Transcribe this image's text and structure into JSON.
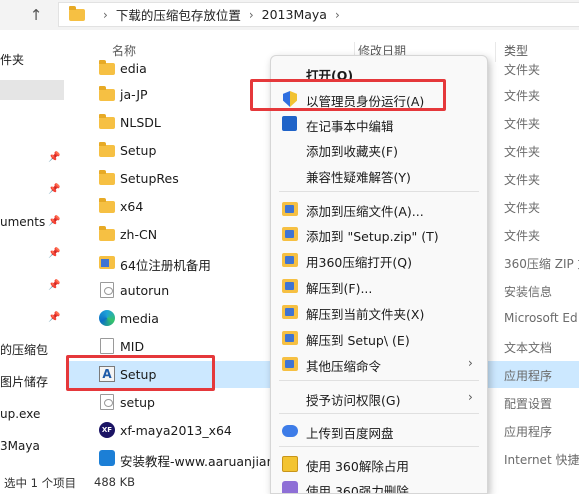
{
  "address_bar": {
    "up_arrow": "↑",
    "separator": "›",
    "crumbs": [
      "下载的压缩包存放位置",
      "2013Maya"
    ]
  },
  "nav": {
    "items": [
      {
        "label": "件夹",
        "pinned": false
      },
      {
        "label": "",
        "pinned": false
      },
      {
        "label": "",
        "pinned": true
      },
      {
        "label": "",
        "pinned": true
      },
      {
        "label": "uments",
        "pinned": true
      },
      {
        "label": "",
        "pinned": true
      },
      {
        "label": "",
        "pinned": true
      },
      {
        "label": "",
        "pinned": true
      },
      {
        "label": "的压缩包",
        "pinned": false
      },
      {
        "label": "图片储存",
        "pinned": false
      },
      {
        "label": "up.exe",
        "pinned": false
      },
      {
        "label": "3Maya",
        "pinned": false
      }
    ]
  },
  "list": {
    "columns": {
      "name": "名称",
      "date": "修改日期",
      "type": "类型"
    },
    "rows": [
      {
        "name": "edia",
        "type": "文件夹",
        "icon": "folder"
      },
      {
        "name": "ja-JP",
        "type": "文件夹",
        "icon": "folder"
      },
      {
        "name": "NLSDL",
        "type": "文件夹",
        "icon": "folder"
      },
      {
        "name": "Setup",
        "type": "文件夹",
        "icon": "folder"
      },
      {
        "name": "SetupRes",
        "type": "文件夹",
        "icon": "folder"
      },
      {
        "name": "x64",
        "type": "文件夹",
        "icon": "folder"
      },
      {
        "name": "zh-CN",
        "type": "文件夹",
        "icon": "folder"
      },
      {
        "name": "64位注册机备用",
        "type": "360压缩 ZIP 文",
        "icon": "zip"
      },
      {
        "name": "autorun",
        "type": "安装信息",
        "icon": "gear-file"
      },
      {
        "name": "media",
        "type": "Microsoft Ed",
        "icon": "edge"
      },
      {
        "name": "MID",
        "type": "文本文档",
        "icon": "doc"
      },
      {
        "name": "Setup",
        "type": "应用程序",
        "icon": "setup-exe",
        "selected": true
      },
      {
        "name": "setup",
        "type": "配置设置",
        "icon": "gear-file"
      },
      {
        "name": "xf-maya2013_x64",
        "type": "应用程序",
        "icon": "xf"
      },
      {
        "name": "安装教程-www.aaruanjian.co",
        "type": "Internet 快捷",
        "icon": "shortcut"
      }
    ]
  },
  "status": {
    "selected": "选中 1 个项目",
    "size": "488 KB"
  },
  "context_menu": {
    "items": [
      {
        "label": "打开(O)",
        "bold": true,
        "icon": "",
        "arrow": false
      },
      {
        "label": "以管理员身份运行(A)",
        "icon": "shield",
        "arrow": false
      },
      {
        "label": "在记事本中编辑",
        "icon": "notepad",
        "arrow": false
      },
      {
        "label": "添加到收藏夹(F)",
        "icon": "",
        "arrow": false
      },
      {
        "label": "兼容性疑难解答(Y)",
        "icon": "",
        "arrow": false
      },
      {
        "label": "添加到压缩文件(A)...",
        "icon": "zip",
        "arrow": false
      },
      {
        "label": "添加到 \"Setup.zip\" (T)",
        "icon": "zip",
        "arrow": false
      },
      {
        "label": "用360压缩打开(Q)",
        "icon": "zip",
        "arrow": false
      },
      {
        "label": "解压到(F)...",
        "icon": "zip",
        "arrow": false
      },
      {
        "label": "解压到当前文件夹(X)",
        "icon": "zip",
        "arrow": false
      },
      {
        "label": "解压到 Setup\\ (E)",
        "icon": "zip",
        "arrow": false
      },
      {
        "label": "其他压缩命令",
        "icon": "zip",
        "arrow": true
      },
      {
        "label": "授予访问权限(G)",
        "icon": "",
        "arrow": true
      },
      {
        "label": "上传到百度网盘",
        "icon": "cloud",
        "arrow": false
      },
      {
        "label": "使用 360解除占用",
        "icon": "occupy",
        "arrow": false
      },
      {
        "label": "使用 360强力删除",
        "icon": "delete",
        "arrow": false
      }
    ],
    "arrow_glyph": "›",
    "pin_glyph": "📌"
  },
  "colors": {
    "highlight": "#e5383b",
    "selection": "#cce8ff"
  }
}
